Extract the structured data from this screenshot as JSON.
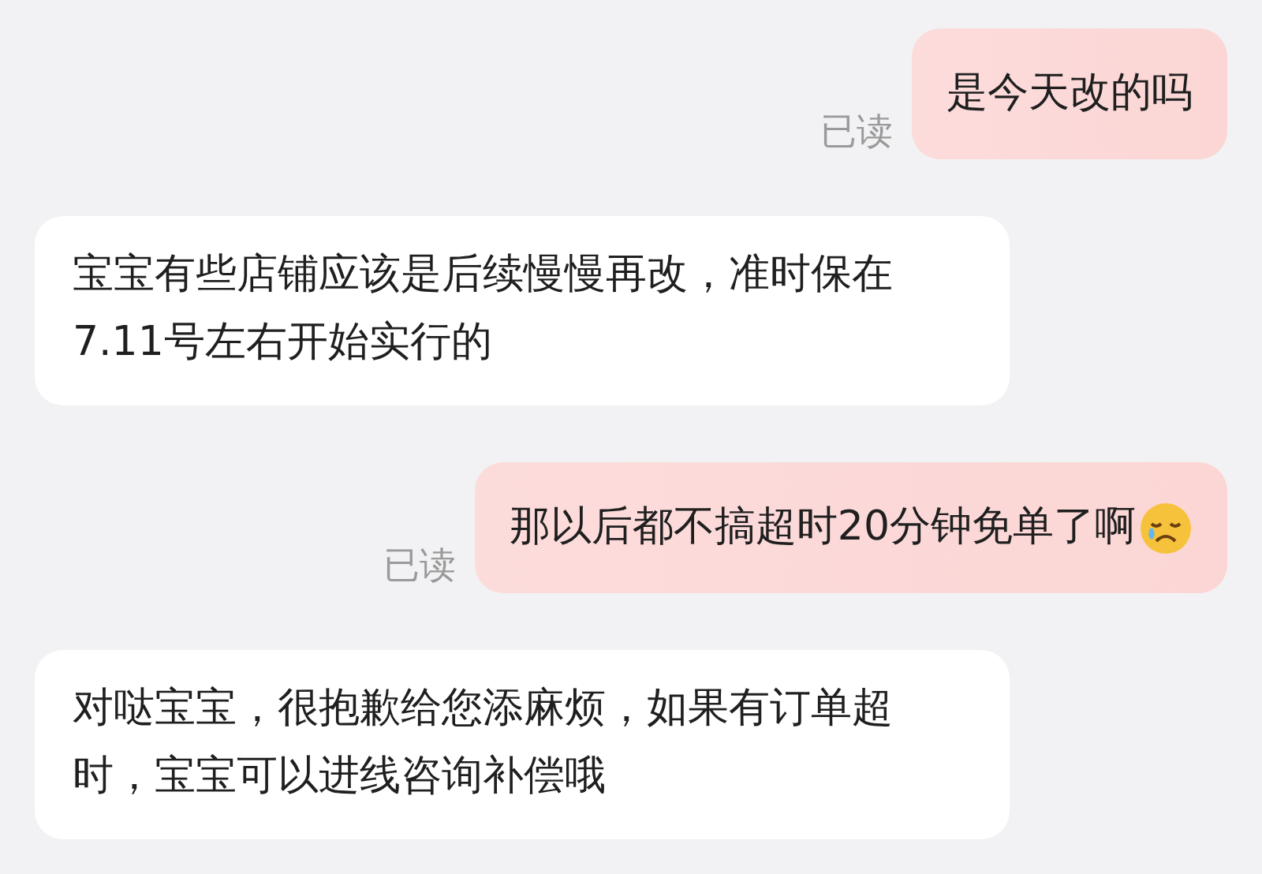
{
  "messages": [
    {
      "kind": "sent",
      "text": "是今天改的吗",
      "receipt": "已读",
      "emoji": false
    },
    {
      "kind": "received",
      "text": "宝宝有些店铺应该是后续慢慢再改，准时保在7.11号左右开始实行的"
    },
    {
      "kind": "sent",
      "text": "那以后都不搞超时20分钟免单了啊",
      "receipt": "已读",
      "emoji": true
    },
    {
      "kind": "received",
      "text": "对哒宝宝，很抱歉给您添麻烦，如果有订单超时，宝宝可以进线咨询补偿哦"
    }
  ]
}
